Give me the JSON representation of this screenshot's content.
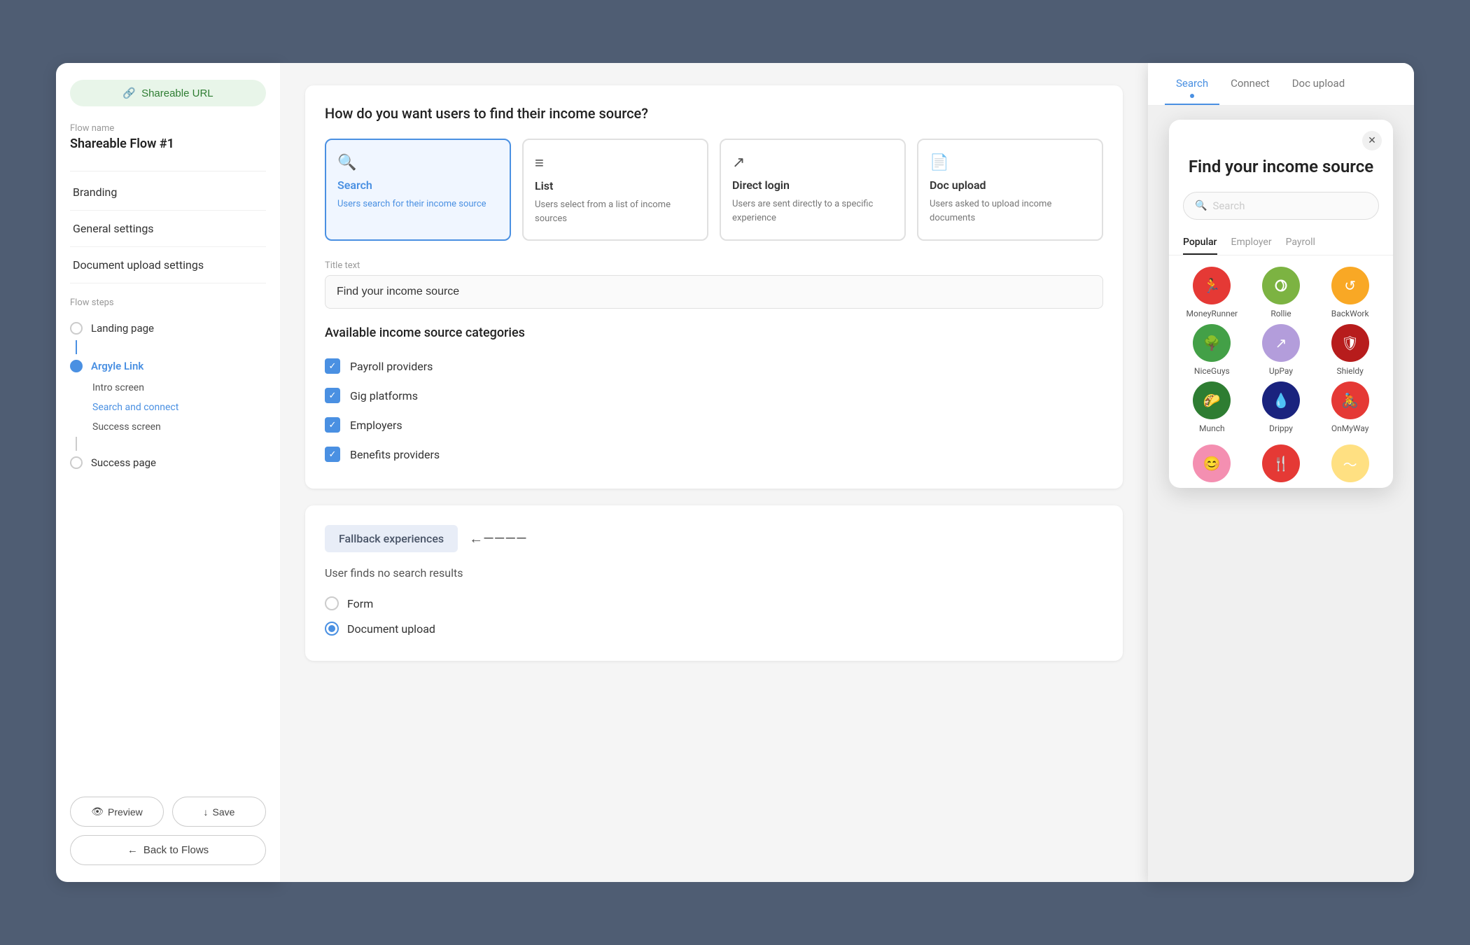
{
  "sidebar": {
    "shareable_url_label": "Shareable URL",
    "flow_name_label": "Flow name",
    "flow_name_value": "Shareable Flow #1",
    "menu": {
      "branding": "Branding",
      "general_settings": "General settings",
      "document_upload_settings": "Document upload settings"
    },
    "flow_steps_label": "Flow steps",
    "steps": [
      {
        "label": "Landing page",
        "type": "circle"
      },
      {
        "label": "Argyle Link",
        "type": "circle-filled"
      },
      {
        "label": "Intro screen",
        "sub": true
      },
      {
        "label": "Search and connect",
        "sub": true,
        "active": true
      },
      {
        "label": "Success screen",
        "sub": true
      },
      {
        "label": "Success page",
        "type": "circle"
      }
    ],
    "buttons": {
      "preview": "Preview",
      "save": "Save",
      "back_to_flows": "Back to Flows"
    }
  },
  "main": {
    "section1": {
      "title": "How do you want users to find their income source?",
      "types": [
        {
          "id": "search",
          "icon": "🔍",
          "name": "Search",
          "desc": "Users search for their income source",
          "selected": true
        },
        {
          "id": "list",
          "icon": "≡",
          "name": "List",
          "desc": "Users select from a list of income sources",
          "selected": false
        },
        {
          "id": "direct_login",
          "icon": "↗",
          "name": "Direct login",
          "desc": "Users are sent directly to a specific experience",
          "selected": false
        },
        {
          "id": "doc_upload",
          "icon": "📄",
          "name": "Doc upload",
          "desc": "Users asked to upload income documents",
          "selected": false
        }
      ]
    },
    "title_text_label": "Title text",
    "title_text_value": "Find your income source",
    "categories": {
      "title": "Available income source categories",
      "items": [
        {
          "label": "Payroll providers",
          "checked": true
        },
        {
          "label": "Gig platforms",
          "checked": true
        },
        {
          "label": "Employers",
          "checked": true
        },
        {
          "label": "Benefits providers",
          "checked": true
        }
      ]
    },
    "fallback": {
      "badge": "Fallback experiences",
      "user_finds_label": "User finds no search results",
      "options": [
        {
          "label": "Form",
          "selected": false
        },
        {
          "label": "Document upload",
          "selected": true
        }
      ]
    }
  },
  "preview": {
    "tabs": [
      {
        "label": "Search",
        "active": true,
        "dot": true
      },
      {
        "label": "Connect",
        "active": false
      },
      {
        "label": "Doc upload",
        "active": false
      }
    ],
    "modal": {
      "title": "Find your income source",
      "search_placeholder": "Search",
      "tabs": [
        {
          "label": "Popular",
          "active": true
        },
        {
          "label": "Employer",
          "active": false
        },
        {
          "label": "Payroll",
          "active": false
        }
      ],
      "providers": [
        {
          "name": "MoneyRunner",
          "color": "#e53935",
          "symbol": "🏃"
        },
        {
          "name": "Rollie",
          "color": "#7cb342",
          "symbol": "↻"
        },
        {
          "name": "BackWork",
          "color": "#f9a825",
          "symbol": "↺"
        },
        {
          "name": "NiceGuys",
          "color": "#43a047",
          "symbol": "🌳"
        },
        {
          "name": "UpPay",
          "color": "#ce93d8",
          "symbol": "↗"
        },
        {
          "name": "Shieldy",
          "color": "#b71c1c",
          "symbol": "🛡"
        },
        {
          "name": "Munch",
          "color": "#2e7d32",
          "symbol": "🌮"
        },
        {
          "name": "Drippy",
          "color": "#1a237e",
          "symbol": "💧"
        },
        {
          "name": "OnMyWay",
          "color": "#e53935",
          "symbol": "🚴"
        }
      ]
    }
  },
  "icons": {
    "link": "🔗",
    "eye": "👁",
    "download": "↓",
    "arrow_left": "←",
    "arrow_right": "→",
    "check": "✓",
    "x": "✕",
    "search": "🔍"
  }
}
